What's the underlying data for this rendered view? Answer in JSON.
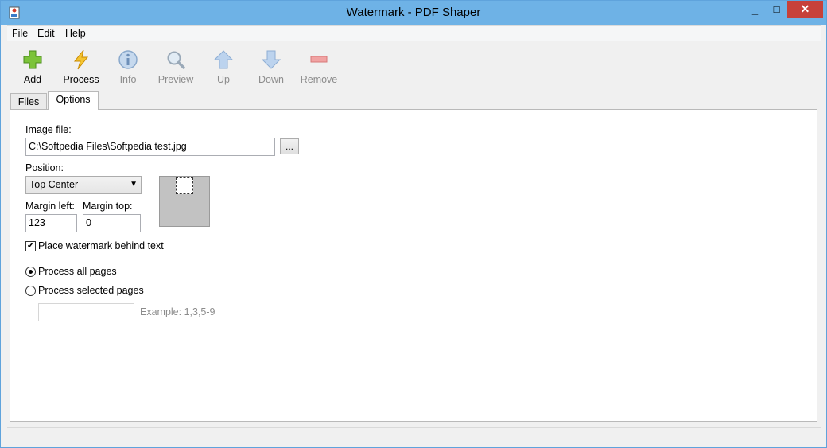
{
  "window": {
    "title": "Watermark - PDF Shaper",
    "min_glyph": "_",
    "max_glyph": "□",
    "close_glyph": "✕"
  },
  "menu": [
    "File",
    "Edit",
    "Help"
  ],
  "toolbar": {
    "add": "Add",
    "process": "Process",
    "info": "Info",
    "preview": "Preview",
    "up": "Up",
    "down": "Down",
    "remove": "Remove"
  },
  "tabs": {
    "files": "Files",
    "options": "Options"
  },
  "options": {
    "image_file_label": "Image file:",
    "image_file_value": "C:\\Softpedia Files\\Softpedia test.jpg",
    "browse_label": "...",
    "position_label": "Position:",
    "position_value": "Top Center",
    "margin_left_label": "Margin left:",
    "margin_left_value": "123",
    "margin_top_label": "Margin top:",
    "margin_top_value": "0",
    "behind_text_label": "Place watermark behind text",
    "behind_text_checked": true,
    "process_all_label": "Process all pages",
    "process_selected_label": "Process selected pages",
    "pages_value": "",
    "pages_example": "Example: 1,3,5-9",
    "selected_mode": "all"
  }
}
